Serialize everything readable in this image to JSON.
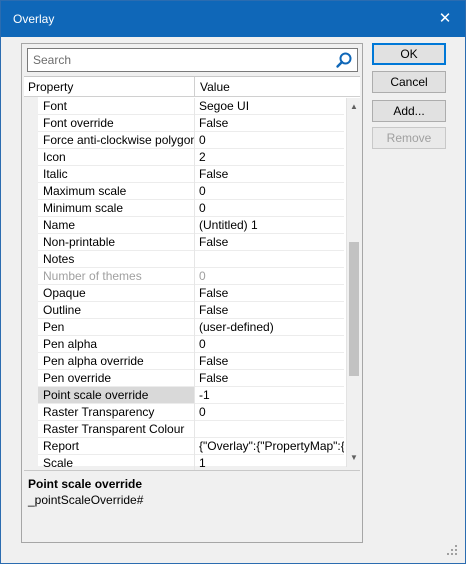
{
  "window": {
    "title": "Overlay"
  },
  "search": {
    "placeholder": "Search"
  },
  "grid": {
    "columns": [
      "Property",
      "Value"
    ],
    "rows": [
      {
        "name": "Font",
        "value": "Segoe UI"
      },
      {
        "name": "Font override",
        "value": "False"
      },
      {
        "name": "Force anti-clockwise polygons",
        "value": "0"
      },
      {
        "name": "Icon",
        "value": "2"
      },
      {
        "name": "Italic",
        "value": "False"
      },
      {
        "name": "Maximum scale",
        "value": "0"
      },
      {
        "name": "Minimum scale",
        "value": "0"
      },
      {
        "name": "Name",
        "value": "(Untitled) 1"
      },
      {
        "name": "Non-printable",
        "value": "False"
      },
      {
        "name": "Notes",
        "value": ""
      },
      {
        "name": "Number of themes",
        "value": "0",
        "disabled": true
      },
      {
        "name": "Opaque",
        "value": "False"
      },
      {
        "name": "Outline",
        "value": "False"
      },
      {
        "name": "Pen",
        "value": " (user-defined)"
      },
      {
        "name": "Pen alpha",
        "value": "0"
      },
      {
        "name": "Pen alpha override",
        "value": "False"
      },
      {
        "name": "Pen override",
        "value": "False"
      },
      {
        "name": "Point scale override",
        "value": "-1",
        "selected": true
      },
      {
        "name": "Raster Transparency",
        "value": "0"
      },
      {
        "name": "Raster Transparent Colour",
        "value": ""
      },
      {
        "name": "Report",
        "value": "{\"Overlay\":{\"PropertyMap\":{..."
      },
      {
        "name": "Scale",
        "value": "1"
      }
    ]
  },
  "description": {
    "title": "Point scale override",
    "text": "_pointScaleOverride#"
  },
  "buttons": {
    "ok": "OK",
    "cancel": "Cancel",
    "add": "Add...",
    "remove": "Remove"
  },
  "icons": {
    "close": "close-icon",
    "search": "search-icon",
    "scroll_up": "scroll-up-icon",
    "scroll_down": "scroll-down-icon",
    "grip": "resize-grip-icon"
  },
  "colors": {
    "titlebar": "#0f67b8",
    "accent": "#0078d7",
    "selected_row": "#d9d9d9"
  }
}
